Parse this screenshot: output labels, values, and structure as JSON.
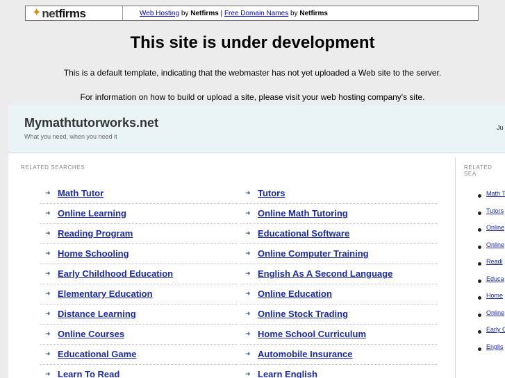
{
  "netfirms_bar": {
    "logo_net": "net",
    "logo_firms": "firms",
    "link_web_hosting": "Web Hosting",
    "by1": " by ",
    "brand1": "Netfirms",
    "sep": " | ",
    "link_domains": "Free Domain Names",
    "by2": " by ",
    "brand2": "Netfirms"
  },
  "notice": {
    "title": "This site is under development",
    "line1": "This is a default template, indicating that the webmaster has not yet uploaded a Web site to the server.",
    "line2": "For information on how to build or upload a site, please visit your web hosting company's site."
  },
  "parked": {
    "site_title": "Mymathtutorworks.net",
    "tagline": "What you need, when you need it",
    "header_right": "Ju",
    "related_label": "RELATED SEARCHES",
    "related_label_side": "RELATED SEA",
    "left_links": [
      "Math Tutor",
      "Online Learning",
      "Reading Program",
      "Home Schooling",
      "Early Childhood Education",
      "Elementary Education",
      "Distance Learning",
      "Online Courses",
      "Educational Game",
      "Learn To Read"
    ],
    "right_links": [
      "Tutors",
      "Online Math Tutoring",
      "Educational Software",
      "Online Computer Training",
      "English As A Second Language",
      "Online Education",
      "Online Stock Trading",
      "Home School Curriculum",
      "Automobile Insurance",
      "Learn English"
    ],
    "side_links": [
      "Math T",
      "Tutors",
      "Online",
      "Online",
      "Readi",
      "Educa",
      "Home",
      "Online",
      "Early C",
      "Englis"
    ]
  }
}
